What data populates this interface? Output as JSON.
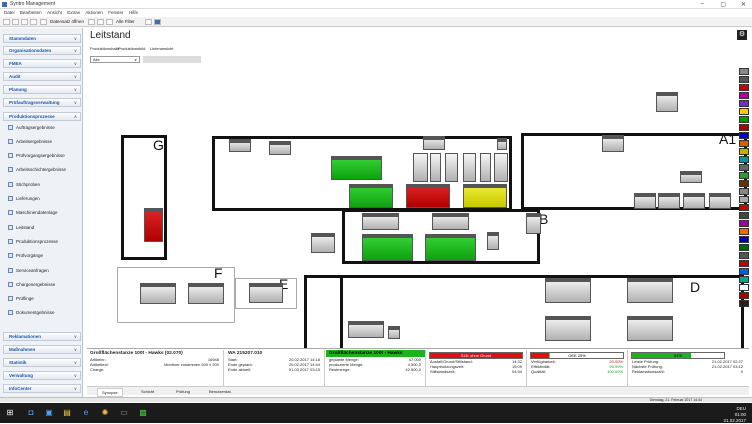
{
  "window": {
    "title": "Syntro Management"
  },
  "menu": [
    "Datei",
    "Bearbeiten",
    "Ansicht",
    "Extras",
    "Aktionen",
    "Fenster",
    "Hilfe"
  ],
  "toolbar": {
    "btn1": "Datensatz öffnen",
    "btn2": "Alle Filter"
  },
  "sidebar": {
    "top_groups": [
      "Stammdaten",
      "Organisationsdaten",
      "FMEA",
      "Audit",
      "Planung",
      "Prüfauftragsverwaltung",
      "Produktionsprozesse"
    ],
    "items": [
      "Auftragsergebnisse",
      "Arbeitsergebnisse",
      "Prüfvorgangsergebnisse",
      "Arbeitsschichtergebnisse",
      "Stichproben",
      "Lieferungen",
      "Maschinendatenlage",
      "Leitstand",
      "Produktionsprozesse",
      "Prüfvorgänge",
      "Serviceanfragen",
      "Chargenergebnisse",
      "Prüflinge",
      "Dokumentgebnisse"
    ],
    "bottom_groups": [
      "Reklamationen",
      "Maßnahmen",
      "Statistik",
      "Verwaltung",
      "InfoCenter"
    ]
  },
  "main": {
    "title": "Leitstand",
    "tabs": [
      "Produktionshalle",
      "Produktionsbild",
      "Linienansicht"
    ],
    "select_value": "Alle"
  },
  "halls": {
    "a": "A1",
    "b": "B",
    "d": "D",
    "e": "E",
    "f": "F",
    "g": "G"
  },
  "color_legend": [
    "#888",
    "#555",
    "#cc0000",
    "#aa00aa",
    "#6633cc",
    "#ffcc00",
    "#009900",
    "#aa0000",
    "#0000cc",
    "#cc6600",
    "#ccaa00",
    "#009999",
    "#666666",
    "#339933",
    "#663300",
    "#888888",
    "#aaaaaa",
    "#cc0000",
    "#444444",
    "#990099",
    "#ff6600",
    "#0000aa",
    "#006600",
    "#555555",
    "#bb0000",
    "#0066cc",
    "#00aa88",
    "#ffffff",
    "#aa0000",
    "#222222"
  ],
  "info": {
    "machine": "Großflächenstanze 100t - Hawks (02.070)",
    "order": "WA 215207.010",
    "fields": [
      {
        "label": "Artikelnr.:",
        "value": "16948"
      },
      {
        "label": "Artikeltext:",
        "value": "Montiner zusammen 500 x 200"
      },
      {
        "label": "Charge:",
        "value": ""
      }
    ],
    "dates": [
      {
        "label": "Start:",
        "value": "20.02.2017 14:18"
      },
      {
        "label": "Ende geplant:",
        "value": "20.02.2017 14:44"
      },
      {
        "label": "Ende aktuell:",
        "value": "01.03.2017 03:15"
      }
    ],
    "panel2_title": "Großflächenstanze 100t - Hawks",
    "qty": [
      {
        "label": "geplante Menge:",
        "value": "47.000"
      },
      {
        "label": "produzierte Menge:",
        "value": "4.500,0"
      },
      {
        "label": "Restmenge:",
        "value": "42.500,0"
      }
    ],
    "status_red": "S18: ohne Grund",
    "times": [
      {
        "label": "Ausfall/Grund/Stillstand:",
        "value": "14:32"
      },
      {
        "label": "Hauptnutzungszeit:",
        "value": "15:09"
      },
      {
        "label": "Stillstandszeit:",
        "value": "04:54"
      }
    ],
    "oee_label": "OEE 20%",
    "oee": [
      {
        "label": "Verfügbarkeit:",
        "value": "20.00%"
      },
      {
        "label": "Effektivität:",
        "value": "99.99%"
      },
      {
        "label": "Qualität:",
        "value": "100.00%"
      }
    ],
    "green_label": "64%",
    "checks": [
      {
        "label": "Letzte Prüfung:",
        "value": "21.02.2017 02:27"
      },
      {
        "label": "Nächste Prüfung:",
        "value": "21.02.2017 03:12"
      },
      {
        "label": "Reklamationszahl:",
        "value": "0"
      }
    ]
  },
  "bottom_tabs": [
    "Synopse",
    "Schicht",
    "Prüfung",
    "Benutzerdat."
  ],
  "status": {
    "text": "Dienstag, 21. Februar 2017 14:44"
  },
  "clock": {
    "time": "01:00",
    "date": "21.02.2017",
    "lang": "DEU"
  }
}
